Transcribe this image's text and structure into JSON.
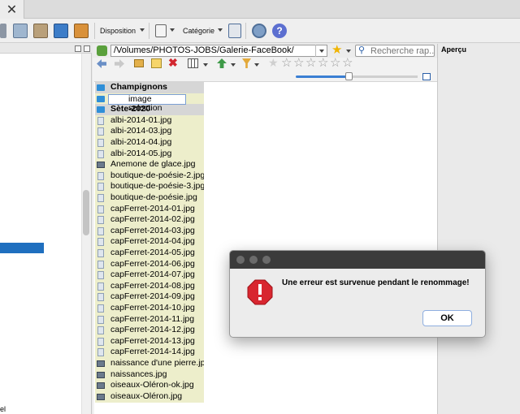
{
  "tab_bar": {
    "close_glyph": "✕"
  },
  "toolbar": {
    "disposition_label": "Disposition",
    "categorie_label": "Catégorie"
  },
  "path_bar": {
    "path": "/Volumes/PHOTOS-JOBS/Galerie-FaceBook/",
    "search_placeholder": "Recherche rap..."
  },
  "right_panel": {
    "title": "Aperçu"
  },
  "left_panel": {
    "bottom_text": "el"
  },
  "file_list": {
    "edit_value": "image selection",
    "items": [
      {
        "label": "Champignons",
        "kind": "folder"
      },
      {
        "label": "",
        "kind": "edit"
      },
      {
        "label": "Sète-2020",
        "kind": "folder"
      },
      {
        "label": "albi-2014-01.jpg",
        "kind": "file"
      },
      {
        "label": "albi-2014-03.jpg",
        "kind": "file"
      },
      {
        "label": "albi-2014-04.jpg",
        "kind": "file"
      },
      {
        "label": "albi-2014-05.jpg",
        "kind": "file"
      },
      {
        "label": "Anemone de glace.jpg",
        "kind": "image"
      },
      {
        "label": "boutique-de-poésie-2.jpg",
        "kind": "file"
      },
      {
        "label": "boutique-de-poésie-3.jpg",
        "kind": "file"
      },
      {
        "label": "boutique-de-poésie.jpg",
        "kind": "file"
      },
      {
        "label": "capFerret-2014-01.jpg",
        "kind": "file"
      },
      {
        "label": "capFerret-2014-02.jpg",
        "kind": "file"
      },
      {
        "label": "capFerret-2014-03.jpg",
        "kind": "file"
      },
      {
        "label": "capFerret-2014-04.jpg",
        "kind": "file"
      },
      {
        "label": "capFerret-2014-05.jpg",
        "kind": "file"
      },
      {
        "label": "capFerret-2014-06.jpg",
        "kind": "file"
      },
      {
        "label": "capFerret-2014-07.jpg",
        "kind": "file"
      },
      {
        "label": "capFerret-2014-08.jpg",
        "kind": "file"
      },
      {
        "label": "capFerret-2014-09.jpg",
        "kind": "file"
      },
      {
        "label": "capFerret-2014-10.jpg",
        "kind": "file"
      },
      {
        "label": "capFerret-2014-11.jpg",
        "kind": "file"
      },
      {
        "label": "capFerret-2014-12.jpg",
        "kind": "file"
      },
      {
        "label": "capFerret-2014-13.jpg",
        "kind": "file"
      },
      {
        "label": "capFerret-2014-14.jpg",
        "kind": "file"
      },
      {
        "label": "naissance d'une pierre.jpg",
        "kind": "image"
      },
      {
        "label": "naissances.jpg",
        "kind": "image"
      },
      {
        "label": "oiseaux-Oléron-ok.jpg",
        "kind": "image"
      },
      {
        "label": "oiseaux-Oléron.jpg",
        "kind": "image"
      }
    ]
  },
  "dialog": {
    "message": "Une erreur est survenue pendant le renommage!",
    "ok_label": "OK",
    "icon": "error-stop-icon"
  },
  "colors": {
    "list_highlight": "#edeecb",
    "selection_blue": "#1f6fbf",
    "error_red": "#d8262f"
  }
}
